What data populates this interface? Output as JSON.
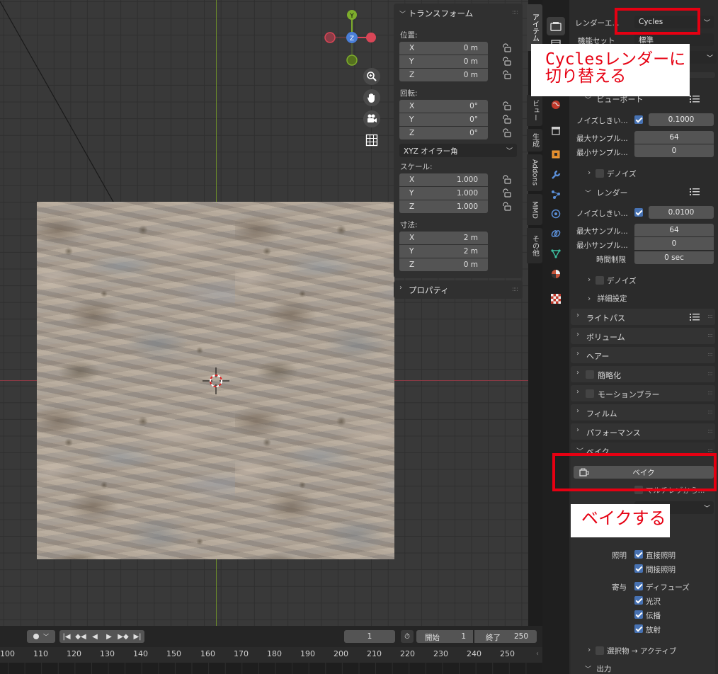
{
  "npanel": {
    "transform_title": "トランスフォーム",
    "location_label": "位置:",
    "location": [
      {
        "axis": "X",
        "value": "0 m"
      },
      {
        "axis": "Y",
        "value": "0 m"
      },
      {
        "axis": "Z",
        "value": "0 m"
      }
    ],
    "rotation_label": "回転:",
    "rotation": [
      {
        "axis": "X",
        "value": "0°"
      },
      {
        "axis": "Y",
        "value": "0°"
      },
      {
        "axis": "Z",
        "value": "0°"
      }
    ],
    "rotation_mode": "XYZ オイラー角",
    "scale_label": "スケール:",
    "scale": [
      {
        "axis": "X",
        "value": "1.000"
      },
      {
        "axis": "Y",
        "value": "1.000"
      },
      {
        "axis": "Z",
        "value": "1.000"
      }
    ],
    "dimensions_label": "寸法:",
    "dimensions": [
      {
        "axis": "X",
        "value": "2 m"
      },
      {
        "axis": "Y",
        "value": "2 m"
      },
      {
        "axis": "Z",
        "value": "0 m"
      }
    ],
    "properties_title": "プロパティ"
  },
  "vtabs": [
    "アイテム",
    "ビュー",
    "生成",
    "Addons",
    "MMD",
    "その他"
  ],
  "gizmo": {
    "y": "Y",
    "z": "Z",
    "x_neg": "",
    "x_pos": ""
  },
  "properties": {
    "render_engine_label": "レンダーエ...",
    "render_engine_value": "Cycles",
    "feature_set_label": "機能セット",
    "feature_set_value": "標準",
    "viewport_title": "ビューポート",
    "noise_threshold_label": "ノイズしきい...",
    "viewport_noise_threshold": "0.1000",
    "max_samples_label": "最大サンプル...",
    "viewport_max_samples": "64",
    "min_samples_label": "最小サンプル...",
    "viewport_min_samples": "0",
    "denoise_label": "デノイズ",
    "render_title": "レンダー",
    "render_noise_threshold": "0.0100",
    "render_max_samples": "64",
    "render_min_samples": "0",
    "time_limit_label": "時間制限",
    "time_limit_value": "0 sec",
    "advanced_label": "詳細設定",
    "light_paths_title": "ライトパス",
    "volumes_title": "ボリューム",
    "hair_title": "ヘアー",
    "simplify_title": "簡略化",
    "motion_blur_title": "モーションブラー",
    "film_title": "フィルム",
    "performance_title": "パフォーマンス",
    "bake_title": "ベイク",
    "bake_button": "ベイク",
    "multires_label": "マルチレゾから...",
    "lighting_label": "照明",
    "direct_label": "直接照明",
    "indirect_label": "間接照明",
    "contributions_label": "寄与",
    "diffuse_label": "ディフューズ",
    "glossy_label": "光沢",
    "transmission_label": "伝播",
    "emit_label": "放射",
    "selected_to_active_label": "選択物 → アクティブ",
    "output_title": "出力"
  },
  "annotations": {
    "cycles_callout_line1": "Cyclesレンダーに",
    "cycles_callout_line2": "切り替える",
    "bake_callout": "ベイクする"
  },
  "timeline": {
    "current_frame": "1",
    "start_label": "開始",
    "start_value": "1",
    "end_label": "終了",
    "end_value": "250",
    "ticks": [
      "100",
      "110",
      "120",
      "130",
      "140",
      "150",
      "160",
      "170",
      "180",
      "190",
      "200",
      "210",
      "220",
      "230",
      "240",
      "250"
    ]
  }
}
